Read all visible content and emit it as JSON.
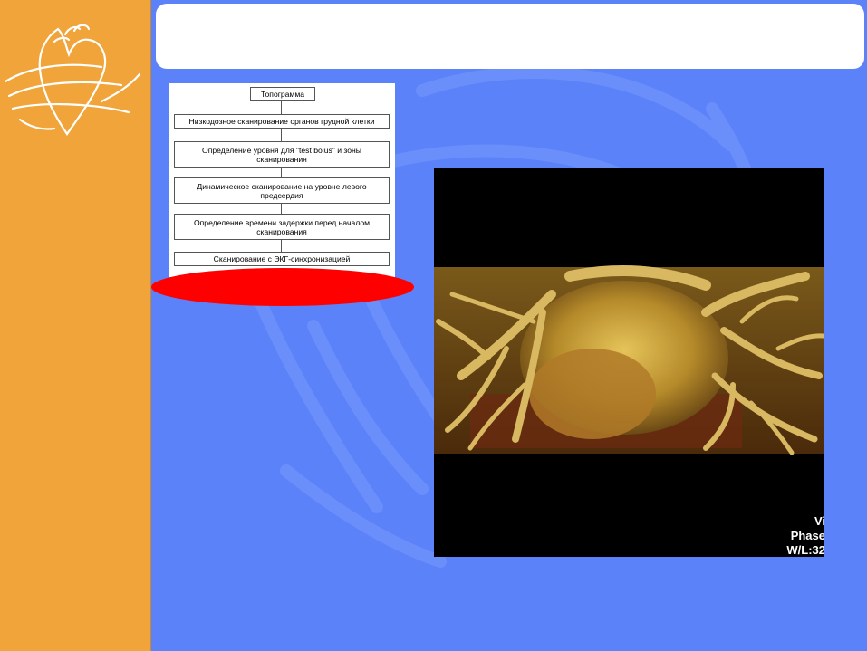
{
  "slide": {
    "title": "",
    "colors": {
      "sidebar": "#f0a43a",
      "background": "#5b82f9",
      "highlight": "#ff0000"
    },
    "logo_icon": "heart-outline-icon"
  },
  "flowchart": {
    "steps": [
      "Топограмма",
      "Низкодозное сканирование органов грудной клетки",
      "Определение уровня для \"test bolus\" и зоны сканирования",
      "Динамическое сканирование на уровне левого предсердия",
      "Определение времени задержки перед началом сканирования",
      "Сканирование с ЭКГ-синхронизацией"
    ]
  },
  "ct_image": {
    "overlay_lines": [
      "Vi",
      "Phase",
      "W/L:32"
    ]
  }
}
